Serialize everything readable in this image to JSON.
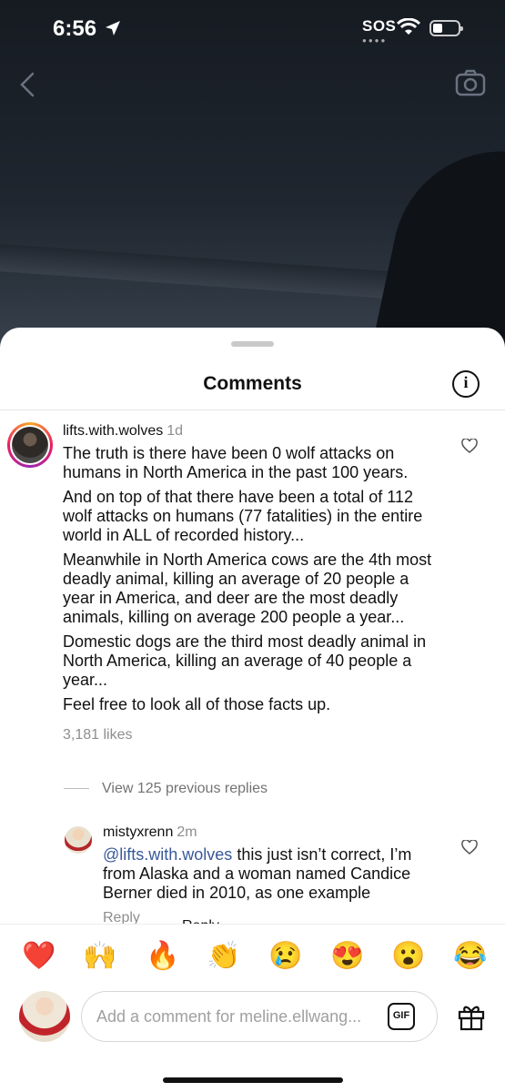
{
  "status_bar": {
    "time": "6:56",
    "sos": "SOS"
  },
  "sheet": {
    "title": "Comments",
    "info_glyph": "i"
  },
  "comment": {
    "username": "lifts.with.wolves",
    "age": "1d",
    "paragraphs": [
      "The truth is there have been 0 wolf attacks on humans in North America in the past 100 years.",
      "And on top of that there have been a total of 112 wolf attacks on humans (77 fatalities) in the entire world in ALL of recorded history...",
      "Meanwhile in North America cows are the 4th most deadly animal, killing an average of 20 people a year in America, and deer are the most deadly animals, killing on average 200 people a year...",
      "Domestic dogs are the third most deadly animal in North America, killing an average of 40 people a year...",
      "Feel free to look all of those facts up."
    ],
    "likes": "3,181 likes",
    "reply_label": "Reply"
  },
  "view_replies": "View 125 previous replies",
  "reply": {
    "username": "mistyxrenn",
    "age": "2m",
    "mention": "@lifts.with.wolves",
    "text": " this just isn’t correct, I’m from Alaska and a woman named Candice Berner died in 2010, as one example",
    "reply_label": "Reply"
  },
  "emojis": [
    "❤️",
    "🙌",
    "🔥",
    "👏",
    "😢",
    "😍",
    "😮",
    "😂"
  ],
  "composer": {
    "placeholder": "Add a comment for meline.ellwang...",
    "gif_label": "GIF"
  },
  "colors": {
    "mention": "#385898",
    "muted": "#8e8e8e"
  }
}
